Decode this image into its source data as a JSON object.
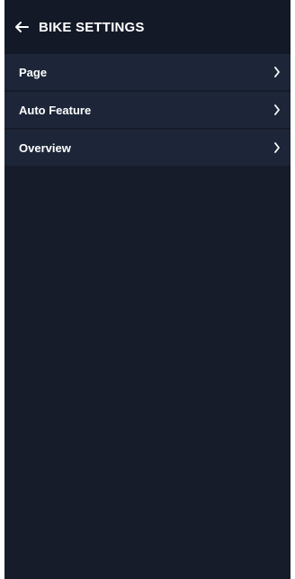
{
  "header": {
    "title": "BIKE SETTINGS",
    "back_icon": "arrow-left-icon"
  },
  "menu": {
    "items": [
      {
        "label": "Page",
        "icon": "chevron-right-icon"
      },
      {
        "label": "Auto Feature",
        "icon": "chevron-right-icon"
      },
      {
        "label": "Overview",
        "icon": "chevron-right-icon"
      }
    ]
  },
  "colors": {
    "background": "#171c2b",
    "header": "#141928",
    "item": "#1d2638",
    "text": "#ffffff"
  }
}
